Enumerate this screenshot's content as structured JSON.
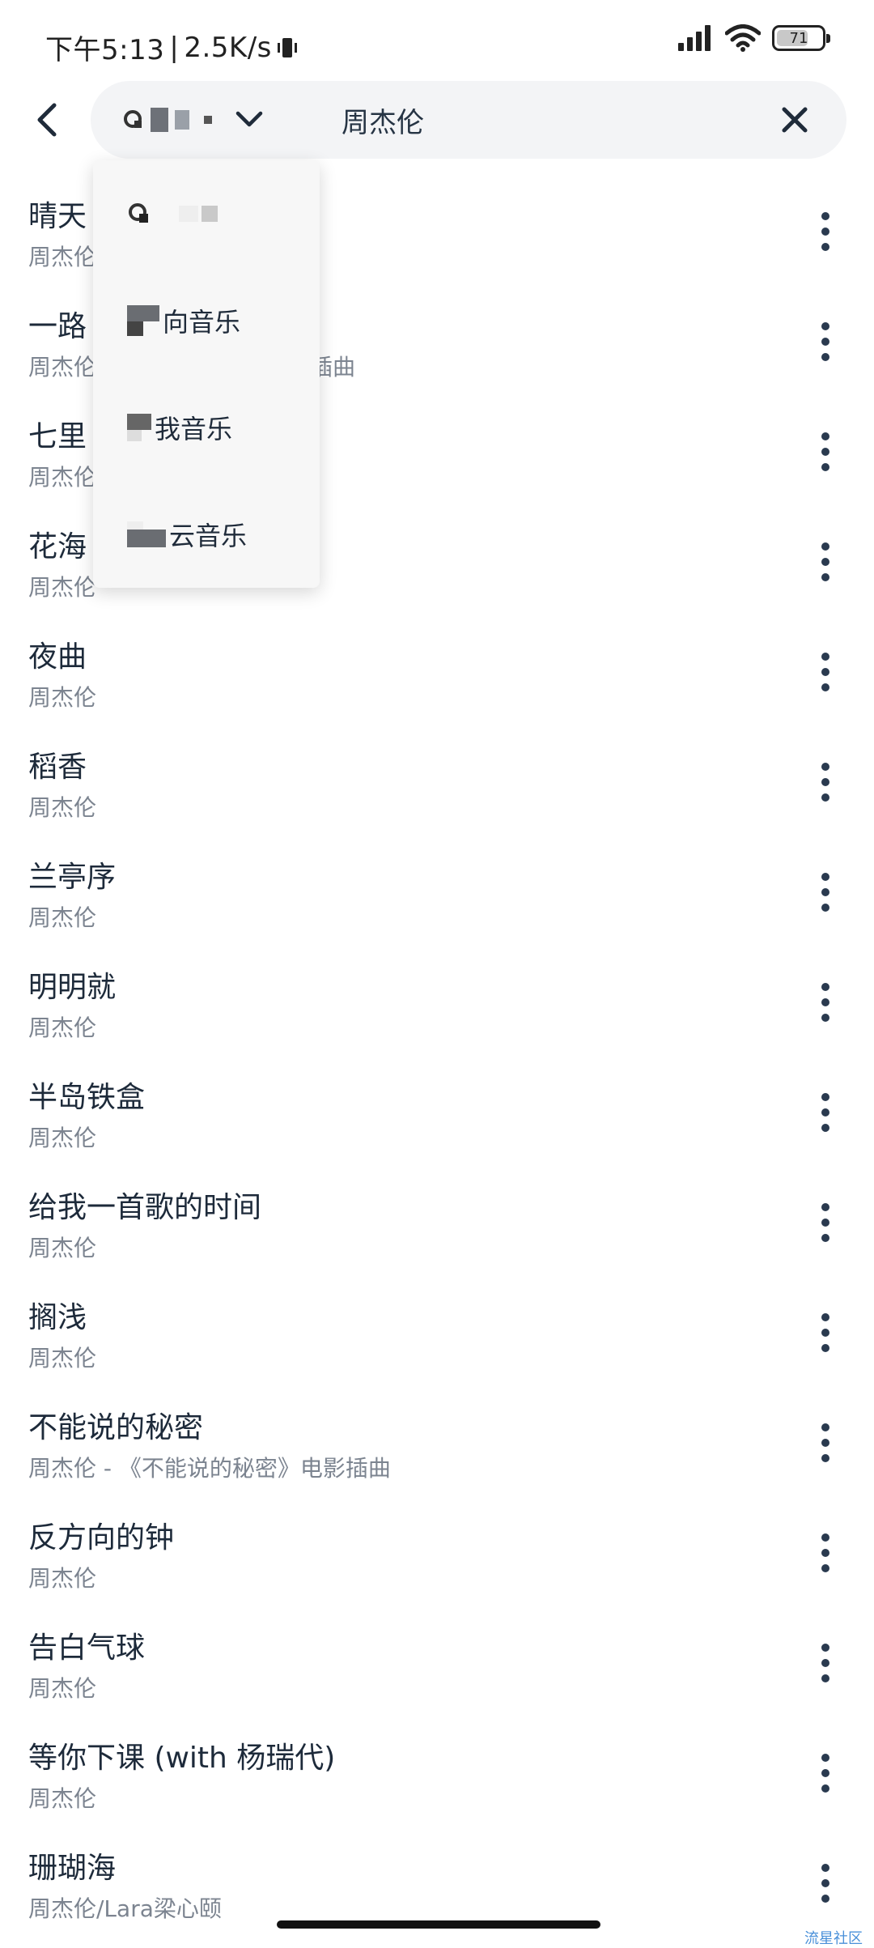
{
  "status_bar": {
    "time": "下午5:13",
    "separator": "|",
    "speed": "2.5K/s",
    "battery": "71",
    "battery_level": 0.71,
    "icons": [
      "vibrate-icon",
      "signal-icon",
      "wifi-icon",
      "battery-icon"
    ]
  },
  "header": {
    "back_icon": "back-chevron-icon",
    "source_icon": "source-logo",
    "dropdown_icon": "chevron-down-icon",
    "query": "周杰伦",
    "clear_icon": "close-icon"
  },
  "dropdown": {
    "items": [
      {
        "label": ""
      },
      {
        "label": "向音乐"
      },
      {
        "label": "我音乐"
      },
      {
        "label": "云音乐"
      }
    ]
  },
  "songs": [
    {
      "title": "晴天",
      "subtitle": "周杰伦"
    },
    {
      "title": "一路",
      "subtitle": "周杰伦",
      "subtitle_tail": "插曲"
    },
    {
      "title": "七里",
      "subtitle": "周杰伦"
    },
    {
      "title": "花海",
      "subtitle": "周杰伦"
    },
    {
      "title": "夜曲",
      "subtitle": "周杰伦"
    },
    {
      "title": "稻香",
      "subtitle": "周杰伦"
    },
    {
      "title": "兰亭序",
      "subtitle": "周杰伦"
    },
    {
      "title": "明明就",
      "subtitle": "周杰伦"
    },
    {
      "title": "半岛铁盒",
      "subtitle": "周杰伦"
    },
    {
      "title": "给我一首歌的时间",
      "subtitle": "周杰伦"
    },
    {
      "title": "搁浅",
      "subtitle": "周杰伦"
    },
    {
      "title": "不能说的秘密",
      "subtitle": "周杰伦 - 《不能说的秘密》电影插曲"
    },
    {
      "title": "反方向的钟",
      "subtitle": "周杰伦"
    },
    {
      "title": "告白气球",
      "subtitle": "周杰伦"
    },
    {
      "title": "等你下课 (with 杨瑞代)",
      "subtitle": "周杰伦"
    },
    {
      "title": "珊瑚海",
      "subtitle": "周杰伦/Lara梁心颐"
    }
  ],
  "more_icon": "more-vertical-icon",
  "watermark": "流星社区"
}
